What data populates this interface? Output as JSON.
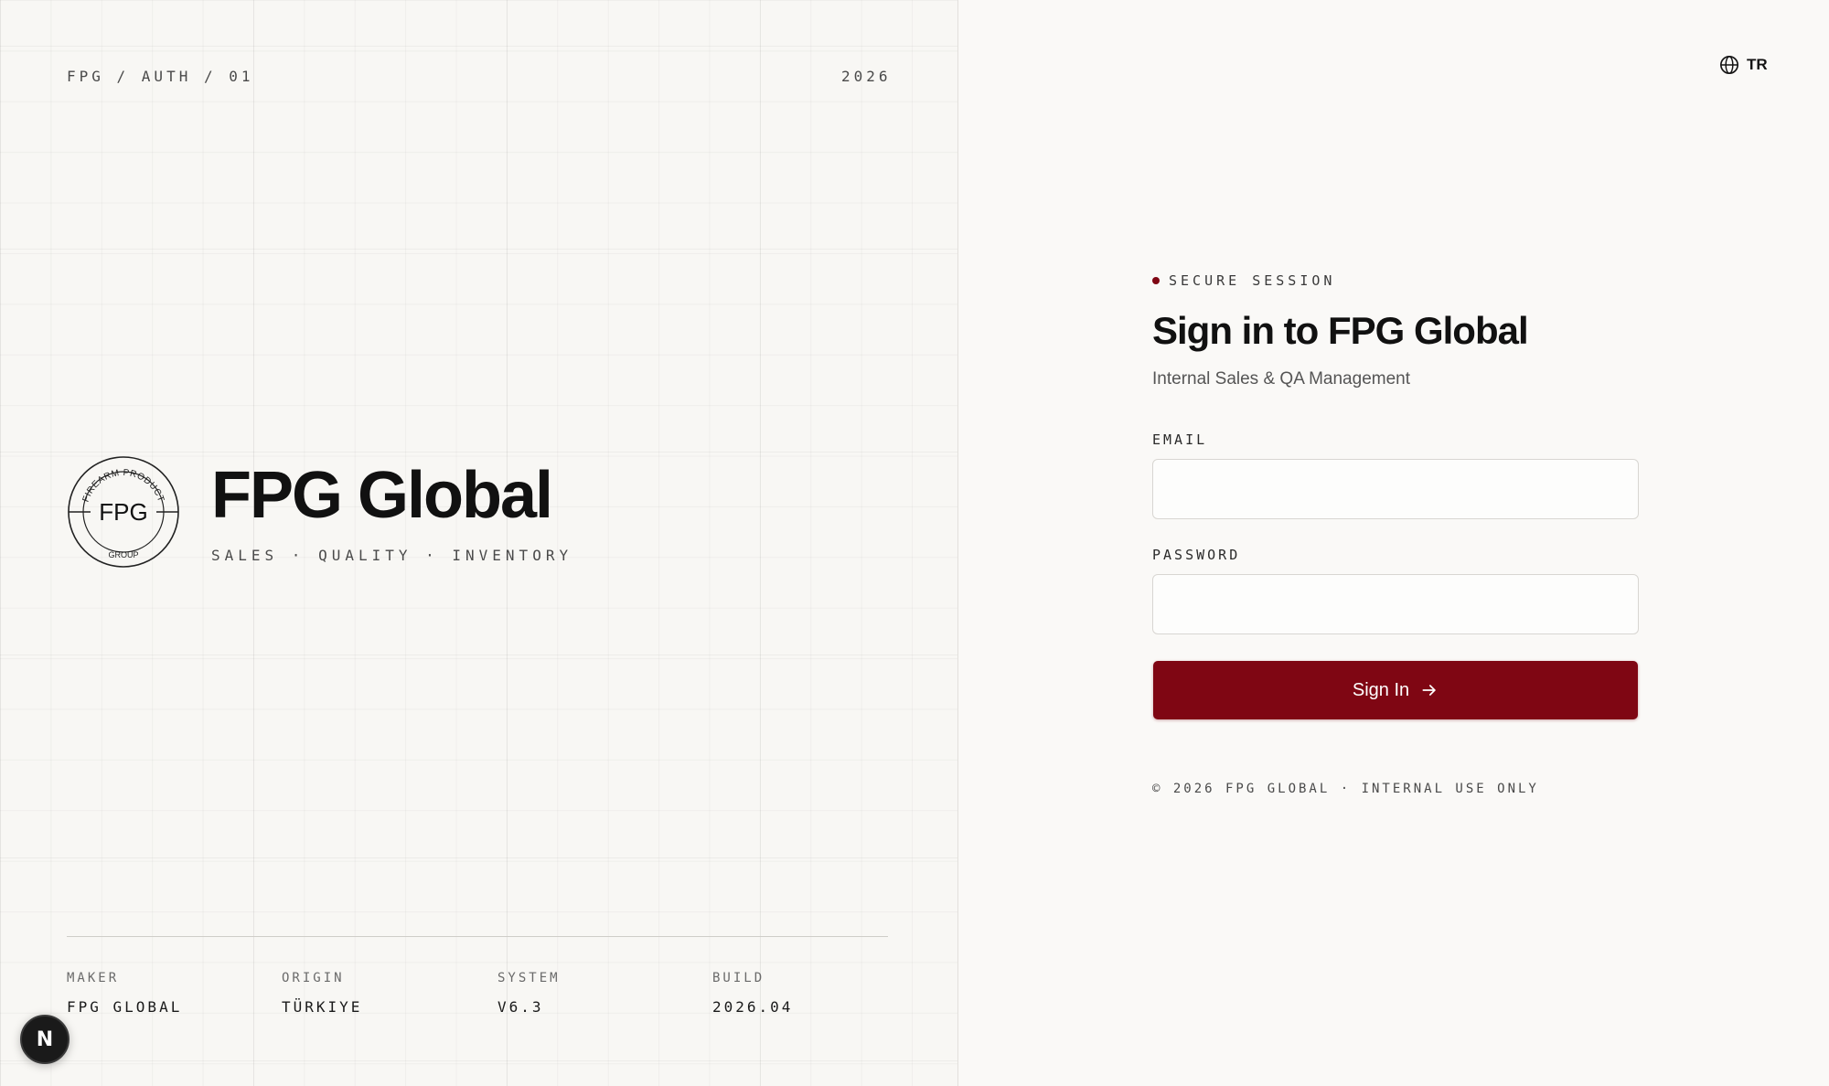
{
  "left": {
    "breadcrumb": "FPG / AUTH / 01",
    "year": "2026",
    "seal": {
      "center_text": "FPG",
      "top_arc_text": "FIREARM PRODUCT",
      "bottom_arc_text": "GROUP"
    },
    "brand_title": "FPG Global",
    "brand_subtitle": "SALES · QUALITY · INVENTORY",
    "meta": [
      {
        "label": "MAKER",
        "value": "FPG GLOBAL"
      },
      {
        "label": "ORIGIN",
        "value": "TÜRKIYE"
      },
      {
        "label": "SYSTEM",
        "value": "V6.3"
      },
      {
        "label": "BUILD",
        "value": "2026.04"
      }
    ],
    "dev_badge": "N"
  },
  "right": {
    "language_label": "TR",
    "secure_label": "SECURE SESSION",
    "title": "Sign in to FPG Global",
    "subtitle": "Internal Sales & QA Management",
    "email_label": "EMAIL",
    "email_value": "",
    "password_label": "PASSWORD",
    "password_value": "",
    "signin_label": "Sign In",
    "footer": "© 2026 FPG GLOBAL · INTERNAL USE ONLY"
  },
  "colors": {
    "accent": "#7f0613",
    "background": "#faf9f7",
    "text": "#141414"
  },
  "icons": {
    "language": "globe-icon",
    "signin": "arrow-right-icon"
  }
}
